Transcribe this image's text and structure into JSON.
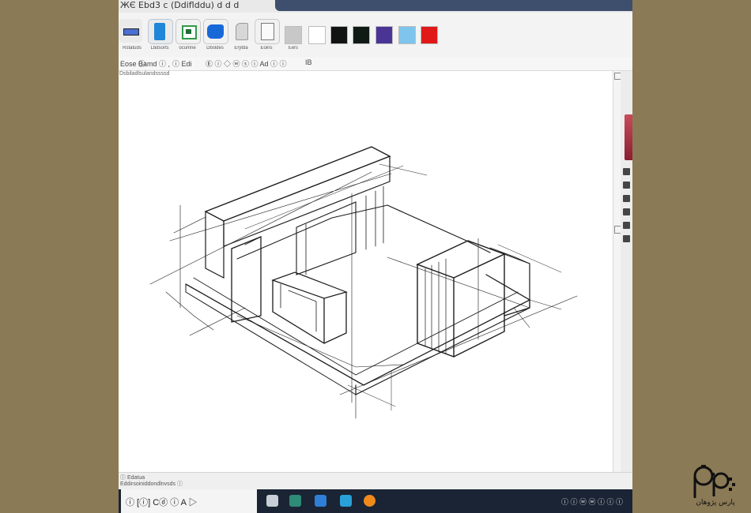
{
  "window": {
    "title_text": "ЖЄ  Ebd3  ⅽ  (Ddiflddu)  ⅾ  ⅾ  ⅾ"
  },
  "ribbon": {
    "tools": [
      {
        "name": "select",
        "label": "Rstatuds"
      },
      {
        "name": "box",
        "label": "Lbdsorts"
      },
      {
        "name": "chip",
        "label": "ocumne"
      },
      {
        "name": "shape",
        "label": "Dbsldes"
      },
      {
        "name": "eraser",
        "label": "Erytda"
      },
      {
        "name": "page",
        "label": "Eoins"
      },
      {
        "name": "swatch-gray",
        "label": "Eers"
      }
    ],
    "swatch_colors": [
      "#c8c8c8",
      "#ffffff",
      "#101312",
      "#0f1a14",
      "#4b3594",
      "#7fc4ec",
      "#e01818"
    ]
  },
  "toolbar": {
    "items": [
      "Eose  ⓘ",
      "Bamd  ⓘ  ,",
      "ⓘ  Edi",
      "Ⓔ ⓘ  ◇  ⓦ  ⓢ  ⓘ  Ad  ⓘ  ⓘ",
      "IB"
    ]
  },
  "canvas": {
    "ruler_label": "Dsbiladlsulandssssd"
  },
  "statusbar": {
    "line1": "ⓘ Edatua",
    "line2": "Eddirsoiniddondlnvsds  ⓘ"
  },
  "taskbar": {
    "quick_text": "ⓘ  [ⓘ]  Cⓓ  ⓘ  A  ▷",
    "tray_text": "ⓘ  ⓘ  ⓦ   ⓦ  ⓘ  ⓘ  ⓘ"
  },
  "colors": {
    "background": "#8b7a56",
    "taskbar": "#1a2434",
    "titlebar_accent": "#3d4f6d"
  },
  "watermark": {
    "text": "پارس پژوهان"
  }
}
